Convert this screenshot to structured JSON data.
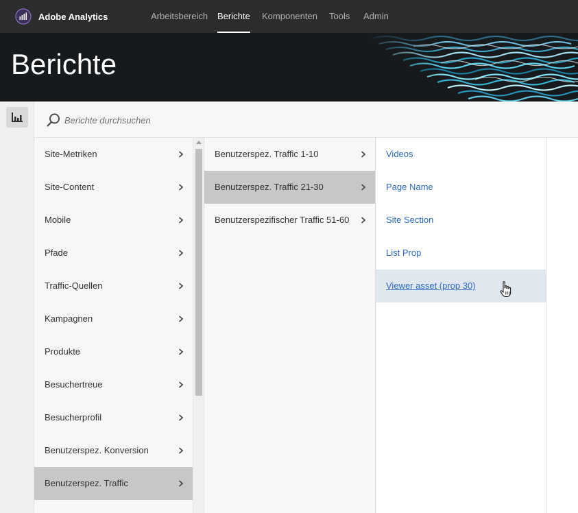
{
  "app": {
    "name": "Adobe Analytics"
  },
  "nav": {
    "items": [
      {
        "label": "Arbeitsbereich",
        "active": false
      },
      {
        "label": "Berichte",
        "active": true
      },
      {
        "label": "Komponenten",
        "active": false
      },
      {
        "label": "Tools",
        "active": false
      },
      {
        "label": "Admin",
        "active": false
      }
    ]
  },
  "hero": {
    "title": "Berichte"
  },
  "search": {
    "placeholder": "Berichte durchsuchen",
    "value": ""
  },
  "columns": {
    "level1": [
      {
        "label": "Site-Metriken"
      },
      {
        "label": "Site-Content"
      },
      {
        "label": "Mobile"
      },
      {
        "label": "Pfade"
      },
      {
        "label": "Traffic-Quellen"
      },
      {
        "label": "Kampagnen"
      },
      {
        "label": "Produkte"
      },
      {
        "label": "Besuchertreue"
      },
      {
        "label": "Besucherprofil"
      },
      {
        "label": "Benutzerspez. Konversion"
      },
      {
        "label": "Benutzerspez. Traffic",
        "selected": true
      }
    ],
    "level2": [
      {
        "label": "Benutzerspez. Traffic 1-10"
      },
      {
        "label": "Benutzerspez. Traffic 21-30",
        "selected": true
      },
      {
        "label": "Benutzerspezifischer Traffic 51-60"
      }
    ],
    "level3": [
      {
        "label": "Videos"
      },
      {
        "label": "Page Name"
      },
      {
        "label": "Site Section"
      },
      {
        "label": "List Prop"
      },
      {
        "label": "Viewer asset (prop 30)",
        "hovered": true
      }
    ]
  },
  "colors": {
    "topbar": "#2c2c2c",
    "link": "#2d6bbe",
    "selected_row": "#c7c7c7",
    "hover_row": "#e1e7ef",
    "brand_accent": "#7b61b8"
  },
  "icons": {
    "brand": "adobe-analytics-logo-icon",
    "rail": "reports-chart-icon",
    "search": "search-icon",
    "chevron": "chevron-right-icon",
    "cursor": "hand-pointer-icon"
  }
}
